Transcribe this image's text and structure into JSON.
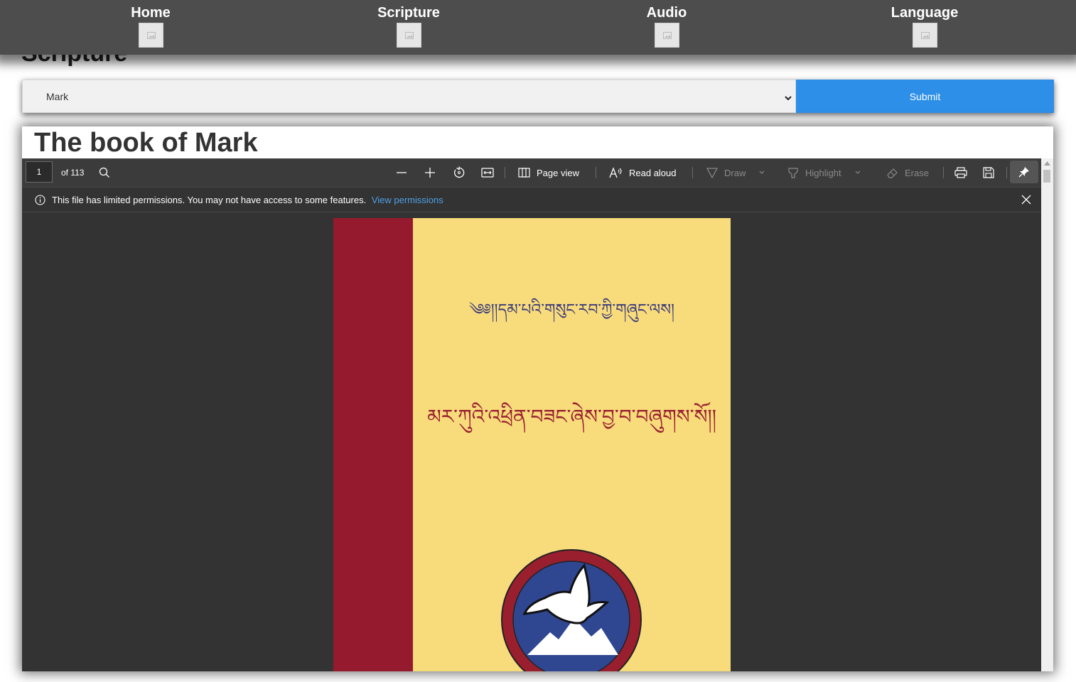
{
  "nav": {
    "items": [
      {
        "label": "Home",
        "icon": "broken-image-icon"
      },
      {
        "label": "Scripture",
        "icon": "broken-image-icon"
      },
      {
        "label": "Audio",
        "icon": "broken-image-icon"
      },
      {
        "label": "Language",
        "icon": "broken-image-icon"
      }
    ]
  },
  "page": {
    "heading": "Scripture"
  },
  "selector": {
    "selected": "Mark",
    "submit_label": "Submit"
  },
  "content": {
    "title": "The book of Mark"
  },
  "pdf_toolbar": {
    "page_number": "1",
    "page_count": "of 113",
    "page_view_label": "Page view",
    "read_aloud_label": "Read aloud",
    "draw_label": "Draw",
    "highlight_label": "Highlight",
    "erase_label": "Erase"
  },
  "permissions_bar": {
    "message": "This file has limited permissions. You may not have access to some features.",
    "link": "View permissions"
  },
  "pdf_page": {
    "top_line": "༄༅།།དམ་པའི་གསུང་རབ་ཀྱི་གཞུང་ལས།",
    "main_line": "མར་ཀུའི་འཕྲིན་བཟང་ཞེས་བྱ་བ་བཞུགས་སོ།།"
  },
  "colors": {
    "nav_bg": "#4d4d4d",
    "submit_bg": "#2d8fe8",
    "viewer_bg": "#333333",
    "cover_yellow": "#f8dc7c",
    "cover_red": "#961a2e",
    "link_blue": "#4ea1e6"
  }
}
